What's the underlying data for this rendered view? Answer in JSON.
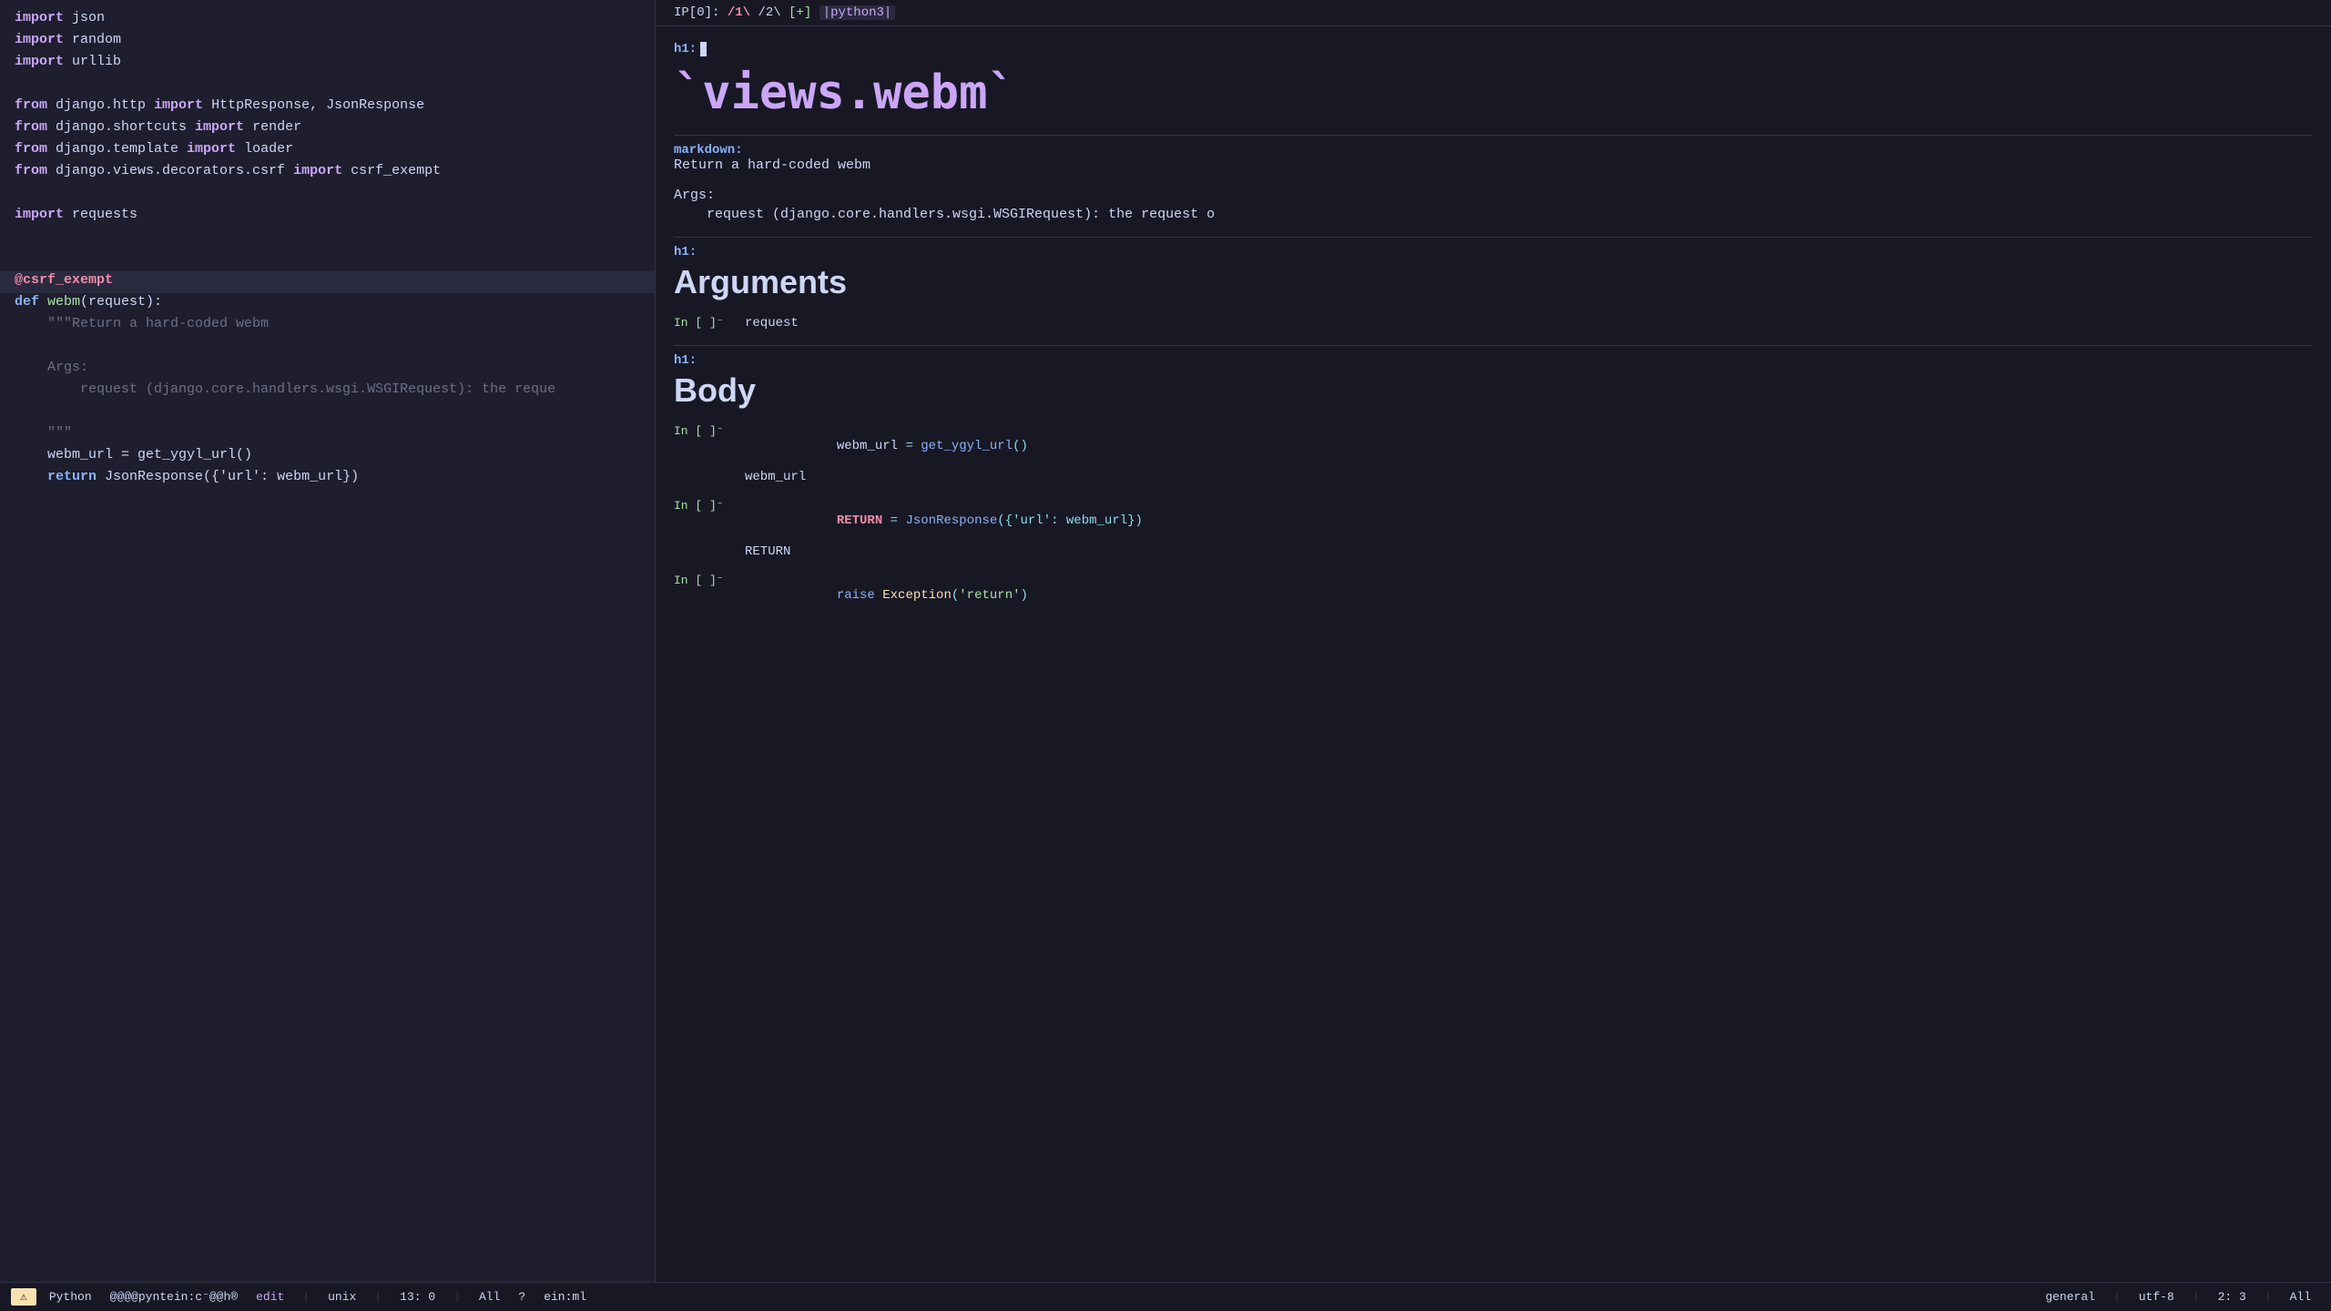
{
  "left_pane": {
    "lines": [
      {
        "type": "import_line",
        "parts": [
          {
            "cls": "kw-import",
            "text": "import"
          },
          {
            "cls": "plain",
            "text": " json"
          }
        ]
      },
      {
        "type": "import_line",
        "parts": [
          {
            "cls": "kw-import",
            "text": "import"
          },
          {
            "cls": "plain",
            "text": " random"
          }
        ]
      },
      {
        "type": "import_line",
        "parts": [
          {
            "cls": "kw-import",
            "text": "import"
          },
          {
            "cls": "plain",
            "text": " urllib"
          }
        ]
      },
      {
        "type": "blank"
      },
      {
        "type": "from_line",
        "parts": [
          {
            "cls": "kw-from",
            "text": "from"
          },
          {
            "cls": "plain",
            "text": " django.http "
          },
          {
            "cls": "kw-import",
            "text": "import"
          },
          {
            "cls": "plain",
            "text": " HttpResponse, JsonResponse"
          }
        ]
      },
      {
        "type": "from_line",
        "parts": [
          {
            "cls": "kw-from",
            "text": "from"
          },
          {
            "cls": "plain",
            "text": " django.shortcuts "
          },
          {
            "cls": "kw-import",
            "text": "import"
          },
          {
            "cls": "plain",
            "text": " render"
          }
        ]
      },
      {
        "type": "from_line",
        "parts": [
          {
            "cls": "kw-from",
            "text": "from"
          },
          {
            "cls": "plain",
            "text": " django.template "
          },
          {
            "cls": "kw-import",
            "text": "import"
          },
          {
            "cls": "plain",
            "text": " loader"
          }
        ]
      },
      {
        "type": "from_line",
        "parts": [
          {
            "cls": "kw-from",
            "text": "from"
          },
          {
            "cls": "plain",
            "text": " django.views.decorators.csrf "
          },
          {
            "cls": "kw-import",
            "text": "import"
          },
          {
            "cls": "plain",
            "text": " csrf_exempt"
          }
        ]
      },
      {
        "type": "blank"
      },
      {
        "type": "import_line",
        "parts": [
          {
            "cls": "kw-import",
            "text": "import"
          },
          {
            "cls": "plain",
            "text": " requests"
          }
        ]
      },
      {
        "type": "blank"
      },
      {
        "type": "blank"
      },
      {
        "type": "decorator",
        "parts": [
          {
            "cls": "decorator",
            "text": "@csrf_exempt"
          }
        ]
      },
      {
        "type": "def_line",
        "parts": [
          {
            "cls": "kw-def",
            "text": "def"
          },
          {
            "cls": "plain",
            "text": " "
          },
          {
            "cls": "fn-name",
            "text": "webm"
          },
          {
            "cls": "plain",
            "text": "(request):"
          }
        ]
      },
      {
        "type": "docstring",
        "parts": [
          {
            "cls": "docstring",
            "text": "    \"\"\"Return a hard-coded webm"
          }
        ]
      },
      {
        "type": "blank"
      },
      {
        "type": "docstring",
        "parts": [
          {
            "cls": "docstring",
            "text": "    Args:"
          }
        ]
      },
      {
        "type": "docstring",
        "parts": [
          {
            "cls": "docstring",
            "text": "        request (django.core.handlers.wsgi.WSGIRequest): the reque"
          }
        ]
      },
      {
        "type": "blank"
      },
      {
        "type": "docstring",
        "parts": [
          {
            "cls": "docstring",
            "text": "    \"\"\""
          }
        ]
      },
      {
        "type": "code",
        "parts": [
          {
            "cls": "plain",
            "text": "    webm_url = get_ygyl_url()"
          }
        ]
      },
      {
        "type": "code",
        "parts": [
          {
            "cls": "plain",
            "text": "    "
          },
          {
            "cls": "kw-return",
            "text": "return"
          },
          {
            "cls": "plain",
            "text": " JsonResponse({'url': webm_url})"
          }
        ]
      },
      {
        "type": "blank"
      },
      {
        "type": "blank"
      },
      {
        "type": "blank"
      },
      {
        "type": "blank"
      },
      {
        "type": "blank"
      },
      {
        "type": "blank"
      }
    ]
  },
  "right_pane": {
    "header": {
      "ip_label": "IP[0]:",
      "path_parts": [
        "/1\\",
        "/2\\",
        "[+]",
        "|python3|"
      ]
    },
    "cells": [
      {
        "type": "h1_with_cursor",
        "h1_tag": "h1:",
        "heading": "`views.webm`"
      },
      {
        "type": "markdown",
        "label": "markdown:",
        "text": "Return a hard-coded webm"
      },
      {
        "type": "args_section",
        "args_label": "Args:",
        "args_text": "    request (django.core.handlers.wsgi.WSGIRequest): the request o"
      },
      {
        "type": "h1",
        "h1_tag": "h1:",
        "heading": "Arguments"
      },
      {
        "type": "input_output",
        "in_label": "In [ ]⁻",
        "code": "request",
        "out": ""
      },
      {
        "type": "h1",
        "h1_tag": "h1:",
        "heading": "Body"
      },
      {
        "type": "input_output",
        "in_label": "In [ ]⁻",
        "code_parts": [
          {
            "cls": "code-var",
            "text": "webm_url"
          },
          {
            "cls": "code-op",
            "text": " = "
          },
          {
            "cls": "code-fn",
            "text": "get_ygyl_url"
          },
          {
            "cls": "code-op",
            "text": "()"
          }
        ],
        "out": "webm_url"
      },
      {
        "type": "input_output",
        "in_label": "In [ ]⁻",
        "code_parts": [
          {
            "cls": "code-kw-return",
            "text": "RETURN"
          },
          {
            "cls": "code-op",
            "text": " = "
          },
          {
            "cls": "code-fn",
            "text": "JsonResponse"
          },
          {
            "cls": "code-op",
            "text": "({'url': webm_url})"
          }
        ],
        "out": "RETURN"
      },
      {
        "type": "input_output",
        "in_label": "In [ ]⁻",
        "code_parts": [
          {
            "cls": "code-kw-raise",
            "text": "raise"
          },
          {
            "cls": "plain",
            "text": " "
          },
          {
            "cls": "code-class",
            "text": "Exception"
          },
          {
            "cls": "code-op",
            "text": "("
          },
          {
            "cls": "code-string",
            "text": "'return'"
          },
          {
            "cls": "code-op",
            "text": ")"
          }
        ],
        "out": ""
      }
    ]
  },
  "status_bar": {
    "warning_icon": "⚠",
    "language": "Python",
    "vim_status": "@@@@pyntein:c⁻@@h®",
    "mode": "edit",
    "file_format": "unix",
    "position": "13: 0",
    "scroll": "All",
    "help_icon": "?",
    "macro": "ein:ml",
    "encoding_section": "general",
    "encoding": "utf-8",
    "cursor_pos": "2: 3",
    "scroll2": "All"
  }
}
